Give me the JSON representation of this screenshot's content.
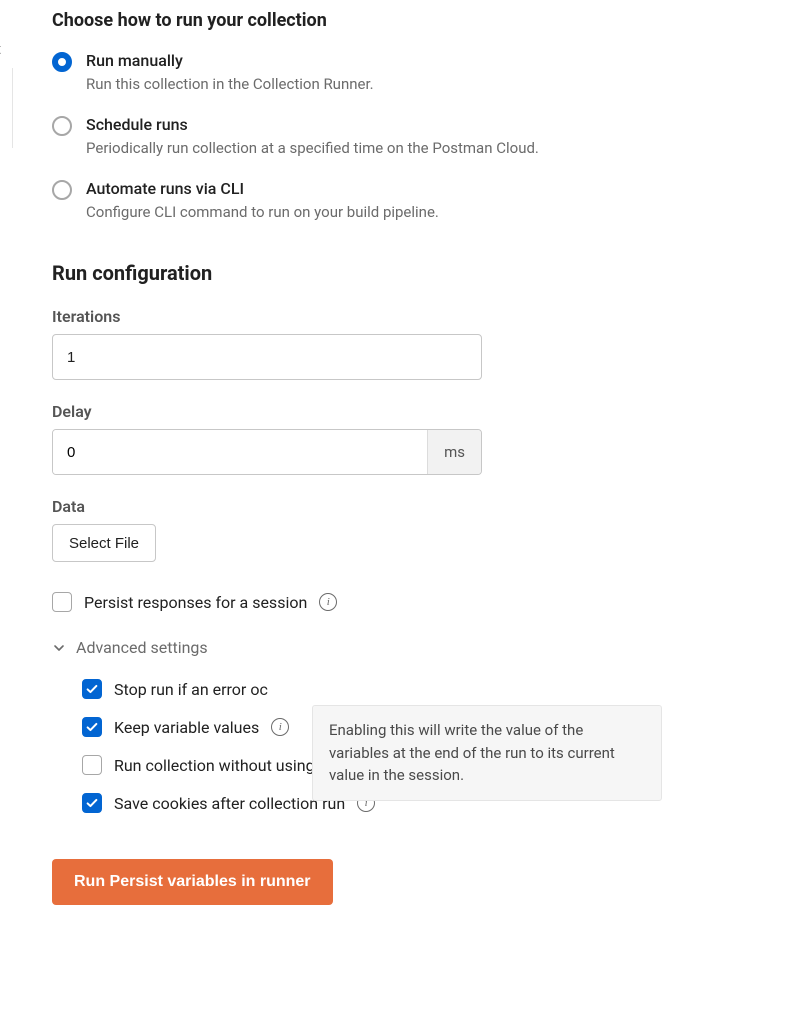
{
  "edge_text": "t",
  "choose_title": "Choose how to run your collection",
  "run_options": [
    {
      "label": "Run manually",
      "desc": "Run this collection in the Collection Runner.",
      "selected": true
    },
    {
      "label": "Schedule runs",
      "desc": "Periodically run collection at a specified time on the Postman Cloud.",
      "selected": false
    },
    {
      "label": "Automate runs via CLI",
      "desc": "Configure CLI command to run on your build pipeline.",
      "selected": false
    }
  ],
  "config_title": "Run configuration",
  "fields": {
    "iterations_label": "Iterations",
    "iterations_value": "1",
    "delay_label": "Delay",
    "delay_value": "0",
    "delay_unit": "ms",
    "data_label": "Data",
    "select_file_label": "Select File"
  },
  "persist_checkbox_label": "Persist responses for a session",
  "advanced_label": "Advanced settings",
  "adv_checks": [
    {
      "label": "Stop run if an error oc",
      "checked": true,
      "info": false
    },
    {
      "label": "Keep variable values",
      "checked": true,
      "info": true
    },
    {
      "label": "Run collection without using stored cookies",
      "checked": false,
      "info": false
    },
    {
      "label": "Save cookies after collection run",
      "checked": true,
      "info": true
    }
  ],
  "tooltip_text": "Enabling this will write the value of the variables at the end of the run to its current value in the session.",
  "run_button_label": "Run Persist variables in runner"
}
